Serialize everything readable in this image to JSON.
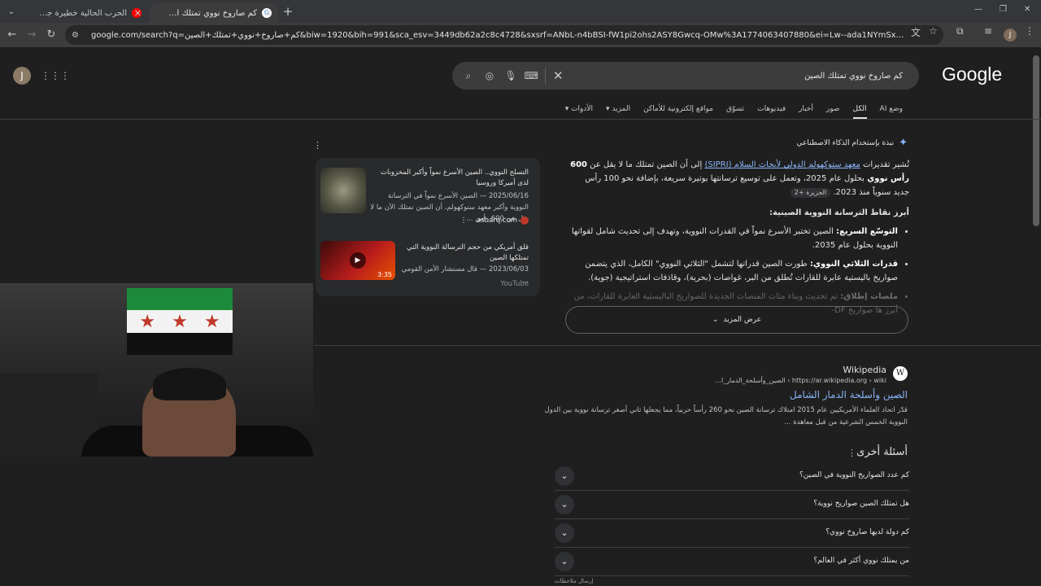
{
  "browser": {
    "tabs": [
      {
        "title": "الحرب الحالية خطيرة جداً والذكاء ال",
        "active": false,
        "favicon_color": "#ff0000"
      },
      {
        "title": "كم صاروخ نووي تمتلك الصين - بـ",
        "active": true,
        "favicon_color": "#4285f4"
      }
    ],
    "new_tab_label": "+",
    "url": "google.com/search?q=كم+صاروخ+نووي+تمتلك+الصين&biw=1920&bih=991&sca_esv=3449db62a2c8c4728&sxsrf=ANbL-n4bBSI-fW1pi2ohs2ASY8Gwcq-OMw%3A1774063407880&ei=Lw--ada1NYmSxc8P547y6QE&oq=كم+صاروخ+نووي+تمتلك+الص...",
    "profile_initial": "J"
  },
  "google": {
    "logo": "Google",
    "query": "كم صاروخ نووي تمتلك الصين",
    "profile_initial": "J",
    "tabs": [
      "وضع AI",
      "الكل",
      "صور",
      "أخبار",
      "فيديوهات",
      "تسوّق",
      "مواقع إلكترونية للأماكن",
      "المزيد",
      "الأدوات"
    ],
    "active_tab": "الكل"
  },
  "ai_overview": {
    "header": "نبذة بإستخدام الذكاء الاصطناعي",
    "p1_pre": "تُشير تقديرات ",
    "p1_link": "معهد ستوكهولم الدولي لأبحاث السلام (SIPRI)",
    "p1_mid": " إلى أن الصين تمتلك ما لا يقل عن ",
    "p1_bold": "600 رأس نووي",
    "p1_post": " بحلول عام 2025، وتعمل على توسيع ترسانتها بوتيرة سريعة، بإضافة نحو 100 رأس جديد سنوياً منذ 2023.",
    "p1_chip": "الجزيرة +2",
    "heading": "أبرز نقاط الترسانة النووية الصينية:",
    "bullets": [
      {
        "bold": "التوسّع السريع:",
        "text": " الصين تختبر الأسرع نمواً في القدرات النووية، وتهدف إلى تحديث شامل لقواتها النووية بحلول عام 2035."
      },
      {
        "bold": "قدرات الثلاثي النووي:",
        "text": " طورت الصين قدراتها لتشمل \"الثلاثي النووي\" الكامل، الذي يتضمن صواريخ باليستية عابرة للقارات تُطلق من البر، غواصات (بحرية)، وقاذفات استراتيجية (جوية)."
      },
      {
        "bold": "ملصات إطلاق:",
        "text": " تم تحديث وبناء مئات المنصات الجديدة للصواريخ الباليستية العابرة للقارات، من أبرز ها صواريخ DF-"
      }
    ],
    "show_more": "عرض المزيد"
  },
  "sources": [
    {
      "title": "التسلح النووي.. الصين الأسرع نمواً وأكبر المخزونات لدى أميركا وروسيا",
      "date_snippet": "2025/06/16 — الصين الأسرع نمواً في الترسانة النووية وأكبر معهد ستوكهولم، أن الصين تمتلك الآن ما لا يقل عن 600 رأس ...",
      "domain": "asharq.com"
    },
    {
      "title": "قلق أمريكي من حجم الترسالة النووية التي تمتلكها الصين",
      "date_snippet": "2023/06/03 — قال مستشار الأمن القومي ...",
      "domain": "YouTube",
      "duration": "3:35"
    }
  ],
  "wiki": {
    "site": "Wikipedia",
    "url": "https://ar.wikipedia.org › wiki › الصين_وأسلحة_الدمار_ا...",
    "title": "الصين وأسلحة الدمار الشامل",
    "snippet": "قدّر اتحاد العلماء الأمريكيين عام 2015 امتلاك ترسانة الصين نحو 260 رأساً حربياً، مما يجعلها ثاني أصغر ترسانة نووية بين الدول النووية الخمس الشرعية من قبل معاهدة ..."
  },
  "paa": {
    "title": "أسئلة أخرى",
    "questions": [
      "كم عدد الصواريخ النووية في الصين؟",
      "هل تمتلك الصين صواريخ نووية؟",
      "كم دولة لديها صاروخ نووي؟",
      "من يمتلك نووي أكثر في العالم؟"
    ],
    "feedback": "إرسال ملاحظات"
  }
}
